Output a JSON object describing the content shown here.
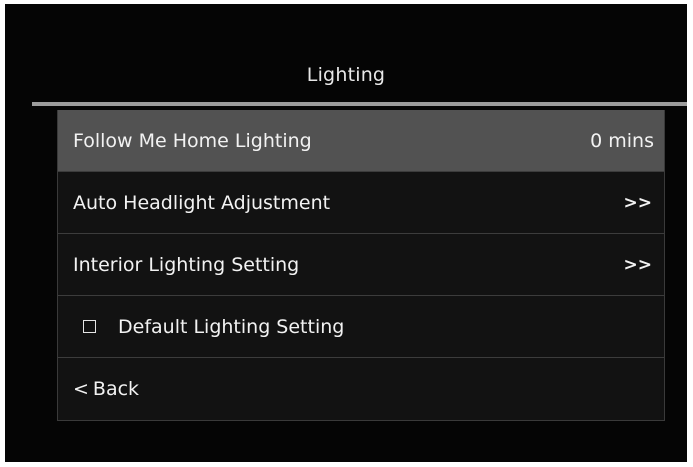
{
  "header": {
    "title": "Lighting"
  },
  "menu": {
    "follow_me_home": {
      "label": "Follow Me Home Lighting",
      "value": "0 mins"
    },
    "auto_headlight": {
      "label": "Auto Headlight Adjustment",
      "chevron": ">>"
    },
    "interior_lighting": {
      "label": "Interior Lighting Setting",
      "chevron": ">>"
    },
    "default_lighting": {
      "label": "Default Lighting Setting",
      "checked": false
    },
    "back": {
      "chevron": "<",
      "label": "Back"
    }
  },
  "colors": {
    "screen_background": "#050505",
    "row_background": "#121212",
    "selected_row_background": "#525252",
    "title_underline": "#9c9c9c",
    "text": "#f2f2f2"
  },
  "icons": {
    "checkbox": "checkbox-unchecked-icon",
    "forward": "double-chevron-right-icon",
    "back": "chevron-left-icon"
  }
}
